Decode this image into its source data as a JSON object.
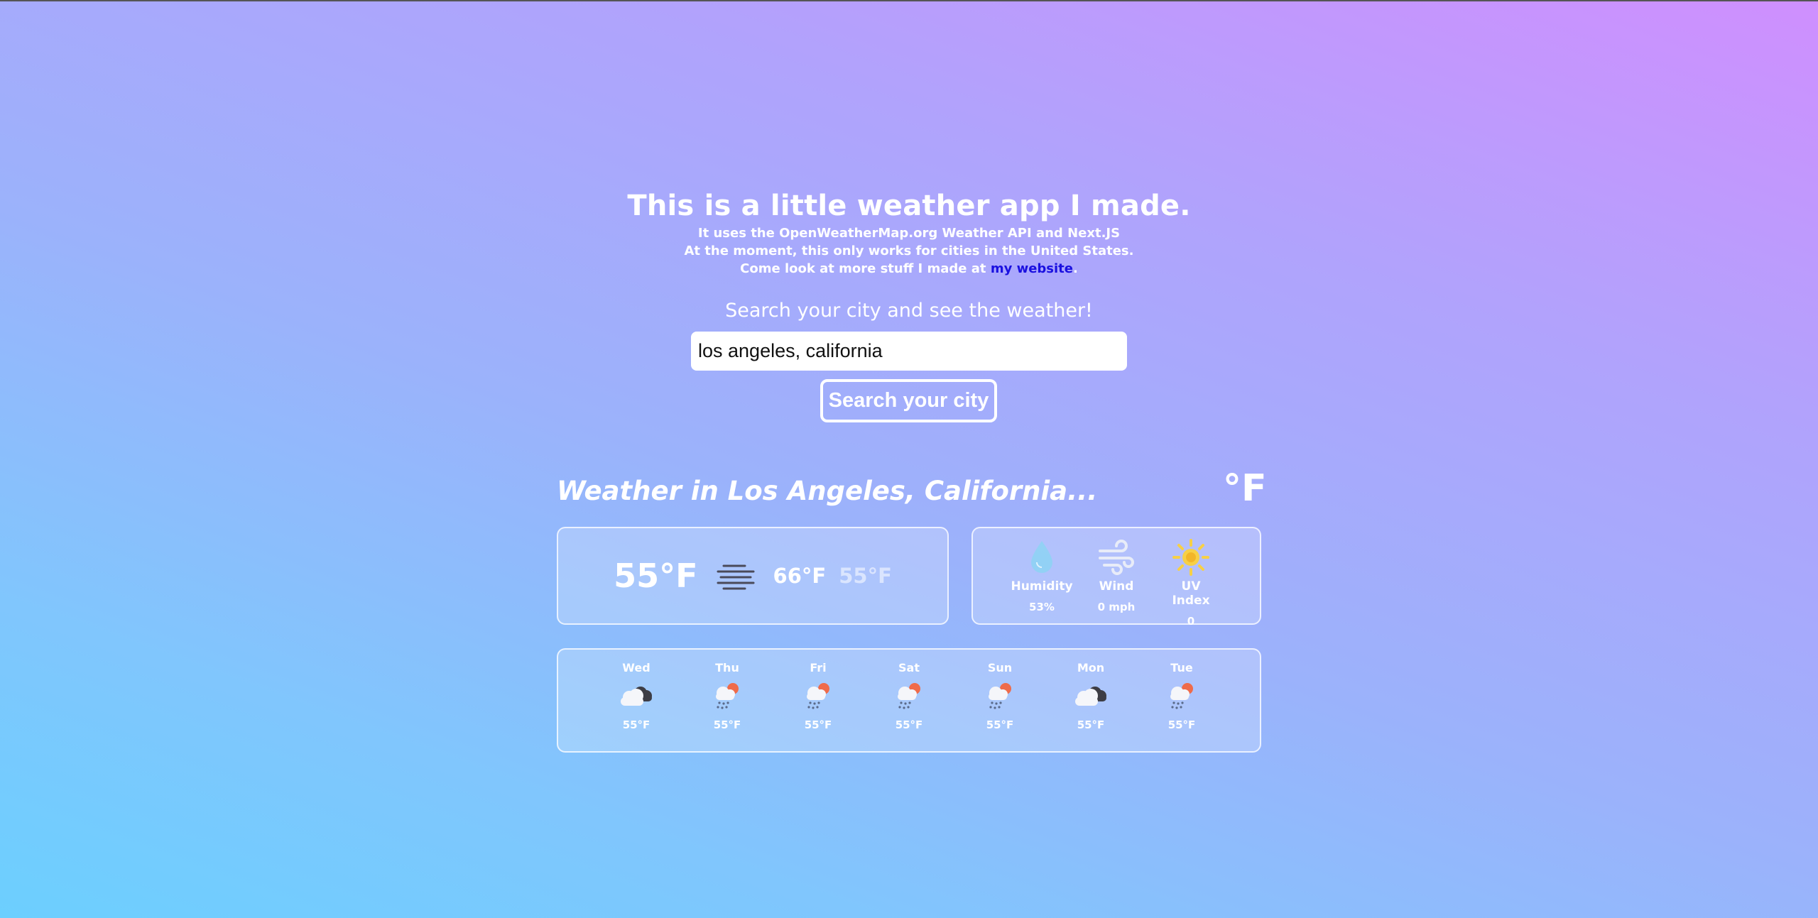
{
  "intro": {
    "heading": "This is a little weather app I made.",
    "line1": "It uses the OpenWeatherMap.org Weather API and Next.JS",
    "line2": "At the moment, this only works for cities in the United States.",
    "line3_prefix": "Come look at more stuff I made at ",
    "line3_link": "my website",
    "line3_suffix": "."
  },
  "search": {
    "heading": "Search your city and see the weather!",
    "input_value": "los angeles, california",
    "button_label": "Search your city"
  },
  "weather": {
    "title": "Weather in Los Angeles, California...",
    "unit": "°F",
    "current_temp": "55°F",
    "condition_icon": "fog-icon",
    "high": "66°F",
    "low": "55°F"
  },
  "stats": [
    {
      "label": "Humidity",
      "value": "53%",
      "icon": "water-drop-icon"
    },
    {
      "label": "Wind",
      "value": "0 mph",
      "icon": "wind-icon"
    },
    {
      "label": "UV Index",
      "value": "0",
      "icon": "sun-icon"
    }
  ],
  "forecast": [
    {
      "day": "Wed",
      "temp": "55°F",
      "icon": "cloudy-icon"
    },
    {
      "day": "Thu",
      "temp": "55°F",
      "icon": "rain-sun-icon"
    },
    {
      "day": "Fri",
      "temp": "55°F",
      "icon": "rain-sun-icon"
    },
    {
      "day": "Sat",
      "temp": "55°F",
      "icon": "rain-sun-icon"
    },
    {
      "day": "Sun",
      "temp": "55°F",
      "icon": "rain-sun-icon"
    },
    {
      "day": "Mon",
      "temp": "55°F",
      "icon": "cloudy-icon"
    },
    {
      "day": "Tue",
      "temp": "55°F",
      "icon": "rain-sun-icon"
    }
  ],
  "colors": {
    "link": "#1a10e0",
    "sun": "#f7d046",
    "drop": "#8fd3f4"
  }
}
